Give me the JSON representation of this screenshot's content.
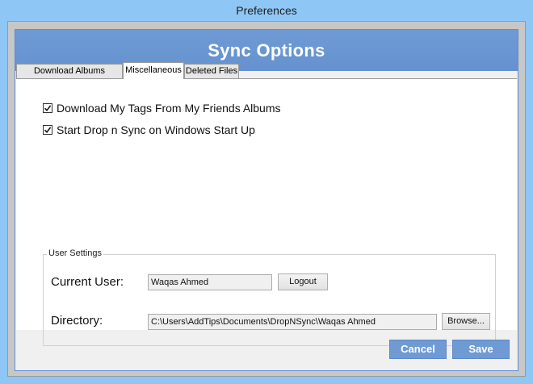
{
  "window": {
    "title": "Preferences"
  },
  "header": {
    "title": "Sync Options"
  },
  "tabs": [
    {
      "label": "Download Albums Settings",
      "active": false
    },
    {
      "label": "Miscellaneous",
      "active": true
    },
    {
      "label": "Deleted Files",
      "active": false
    }
  ],
  "options": [
    {
      "label": "Download My Tags From My Friends Albums",
      "checked": true
    },
    {
      "label": "Start Drop n Sync on Windows Start Up",
      "checked": true
    }
  ],
  "user_settings": {
    "legend": "User Settings",
    "current_user_label": "Current User:",
    "current_user_value": "Waqas Ahmed",
    "logout_label": "Logout",
    "directory_label": "Directory:",
    "directory_value": "C:\\Users\\AddTips\\Documents\\DropNSync\\Waqas Ahmed",
    "browse_label": "Browse..."
  },
  "footer": {
    "cancel_label": "Cancel",
    "save_label": "Save"
  },
  "colors": {
    "accent": "#6f9ad4",
    "window_bg": "#8ec7f6"
  }
}
